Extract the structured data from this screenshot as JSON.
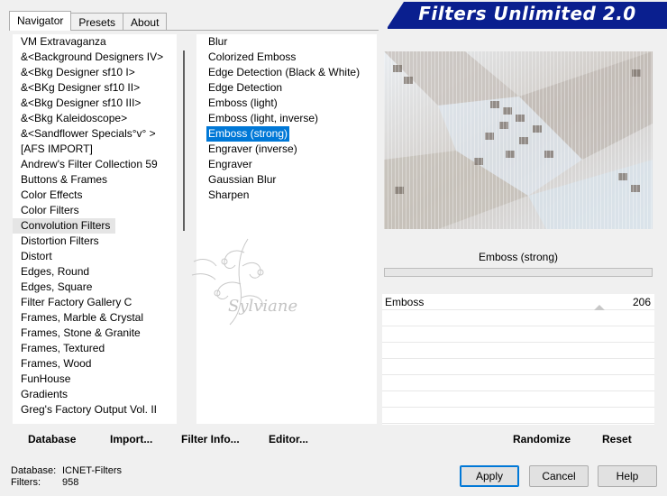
{
  "tabs": [
    "Navigator",
    "Presets",
    "About"
  ],
  "banner_title": "Filters Unlimited 2.0",
  "categories": [
    " VM Extravaganza",
    "&<Background Designers IV>",
    "&<Bkg Designer sf10 I>",
    "&<BKg Designer sf10 II>",
    "&<Bkg Designer sf10 III>",
    "&<Bkg Kaleidoscope>",
    "&<Sandflower Specials°v° >",
    "[AFS IMPORT]",
    "Andrew's Filter Collection 59",
    "Buttons & Frames",
    "Color Effects",
    "Color Filters",
    "Convolution Filters",
    "Distortion Filters",
    "Distort",
    "Edges, Round",
    "Edges, Square",
    "Filter Factory Gallery C",
    "Frames, Marble & Crystal",
    "Frames, Stone & Granite",
    "Frames, Textured",
    "Frames, Wood",
    "FunHouse",
    "Gradients",
    "Greg's Factory Output Vol. II"
  ],
  "selected_category": "Convolution Filters",
  "filters": [
    "Blur",
    "Colorized Emboss",
    "Edge Detection (Black & White)",
    "Edge Detection",
    "Emboss (light)",
    "Emboss (light, inverse)",
    "Emboss (strong)",
    "Engraver (inverse)",
    "Engraver",
    "Gaussian Blur",
    "Sharpen"
  ],
  "selected_filter": "Emboss (strong)",
  "watermark_text": "Sylviane",
  "preview_name": "Emboss (strong)",
  "parameter": {
    "label": "Emboss",
    "value": "206",
    "level": 0.81
  },
  "toolbar": {
    "database": "Database",
    "import": "Import...",
    "filter_info": "Filter Info...",
    "editor": "Editor...",
    "randomize": "Randomize",
    "reset": "Reset"
  },
  "status": {
    "database_key": "Database:",
    "database_val": "ICNET-Filters",
    "filters_key": "Filters:",
    "filters_val": "958"
  },
  "buttons": {
    "apply": "Apply",
    "cancel": "Cancel",
    "help": "Help"
  },
  "colors": {
    "banner": "#0a1f8f",
    "selection": "#0078d7"
  }
}
